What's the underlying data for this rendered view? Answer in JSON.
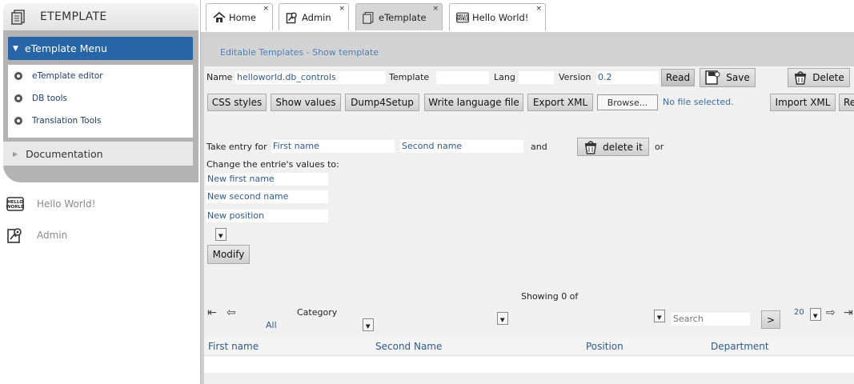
{
  "app": {
    "title": "ETEMPLATE"
  },
  "sidebar": {
    "menu_title": "eTemplate Menu",
    "items": [
      {
        "label": "eTemplate editor"
      },
      {
        "label": "DB tools"
      },
      {
        "label": "Translation Tools"
      }
    ],
    "documentation": "Documentation",
    "links": [
      {
        "label": "Hello World!",
        "icon": "hello-world-icon"
      },
      {
        "label": "Admin",
        "icon": "admin-icon"
      }
    ]
  },
  "tabs": [
    {
      "label": "Home",
      "icon": "home-icon",
      "close": "×"
    },
    {
      "label": "Admin",
      "icon": "admin-icon",
      "close": "×"
    },
    {
      "label": "eTemplate",
      "icon": "etemplate-icon",
      "close": "×",
      "active": true
    },
    {
      "label": "Hello World!",
      "icon": "hello-world-icon",
      "close": "×"
    }
  ],
  "breadcrumb": "Editable Templates - Show template",
  "form": {
    "name_label": "Name",
    "name_value": "helloworld.db_controls",
    "template_label": "Template",
    "template_value": "",
    "lang_label": "Lang",
    "lang_value": "",
    "version_label": "Version",
    "version_value": "0.2",
    "read": "Read",
    "save": "Save",
    "delete": "Delete"
  },
  "toolbar": {
    "css_styles": "CSS styles",
    "show_values": "Show values",
    "dump4setup": "Dump4Setup",
    "write_language_file": "Write language file",
    "export_xml": "Export XML",
    "browse": "Browse...",
    "file_status": "No file selected.",
    "import_xml": "Import XML",
    "more": "Re"
  },
  "entry": {
    "take_entry_for": "Take entry for",
    "first_name_placeholder": "First name",
    "second_name_placeholder": "Second name",
    "and": "and",
    "delete_it": "delete it",
    "or": "or",
    "change_values": "Change the entrie's values to:",
    "new_first_name": "New first name",
    "new_second_name": "New second name",
    "new_position": "New position",
    "modify": "Modify"
  },
  "list": {
    "showing": "Showing 0 of",
    "category_label": "Category",
    "category_value": "All",
    "search_placeholder": "Search",
    "go": ">",
    "page_size": "20",
    "columns": [
      "First name",
      "Second Name",
      "Position",
      "Department"
    ]
  },
  "colors": {
    "accent": "#2765a8",
    "link": "#2f5a8f"
  }
}
